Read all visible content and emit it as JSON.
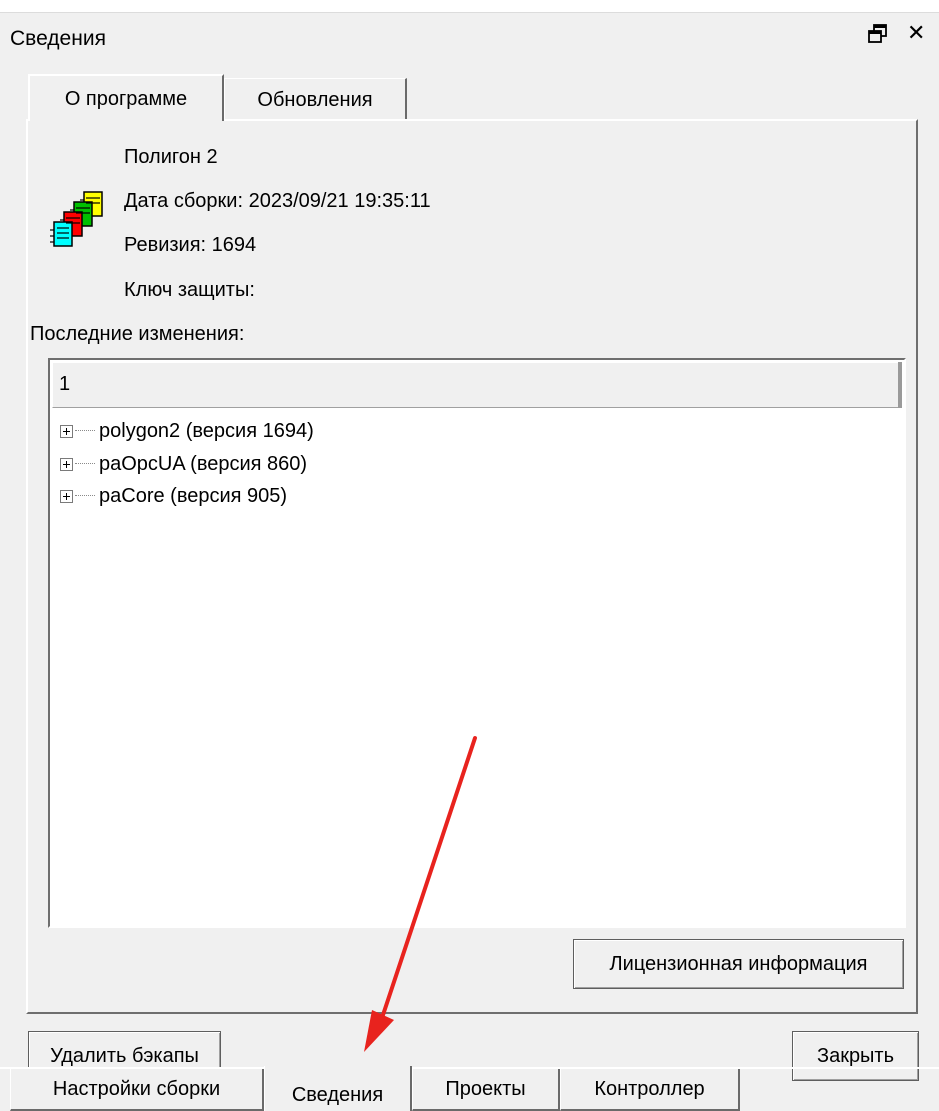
{
  "window": {
    "title": "Сведения"
  },
  "tabs": [
    "О программе",
    "Обновления"
  ],
  "about": {
    "product": "Полигон 2",
    "build_date": "Дата сборки: 2023/09/21 19:35:11",
    "revision": "Ревизия: 1694",
    "protection_key": "Ключ защиты:",
    "changes_label": "Последние изменения:"
  },
  "tree": {
    "column_header": "1",
    "items": [
      {
        "label": "polygon2 (версия 1694)"
      },
      {
        "label": "paOpcUA (версия 860)"
      },
      {
        "label": "paCore (версия 905)"
      }
    ]
  },
  "buttons": {
    "license": "Лицензионная информация",
    "delete_backups": "Удалить бэкапы",
    "close": "Закрыть"
  },
  "bottom_tabs": [
    "Настройки сборки",
    "Сведения",
    "Проекты",
    "Контроллер"
  ],
  "icons": {
    "window_float": "float-window-icon",
    "window_close": "close-icon",
    "app": "documents-icon",
    "annotation": "red-arrow"
  },
  "colors": {
    "annotation_arrow": "#e8231e"
  }
}
